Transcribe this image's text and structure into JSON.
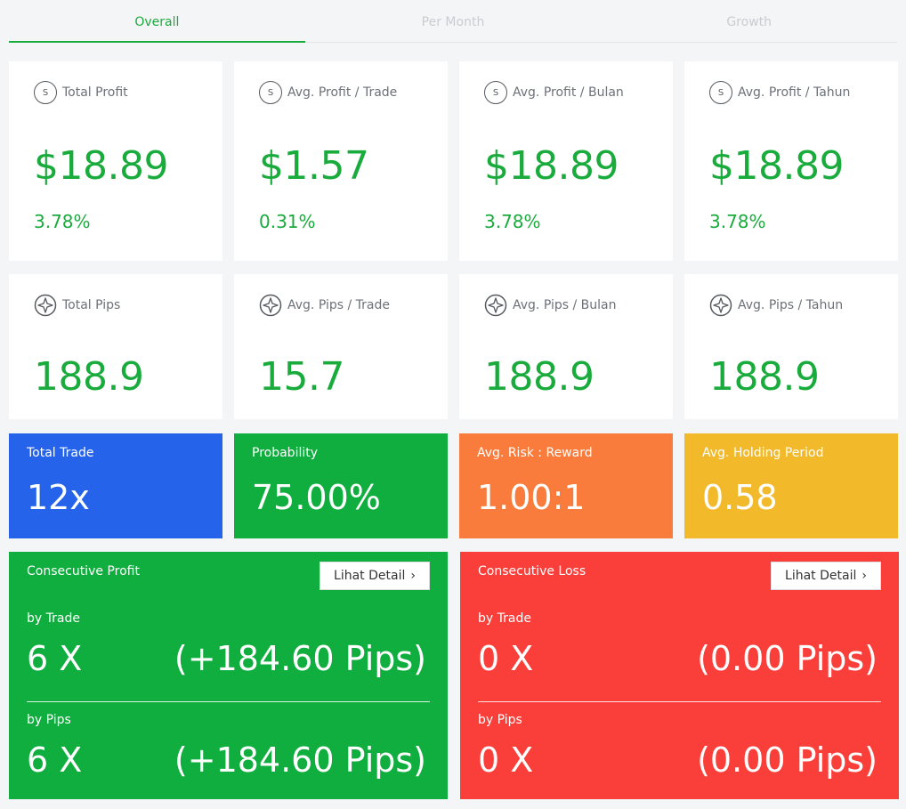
{
  "tabs": [
    "Overall",
    "Per Month",
    "Growth"
  ],
  "profit_cards": [
    {
      "label": "Total Profit",
      "value": "$18.89",
      "pct": "3.78%",
      "icon": "dollar-coin-icon"
    },
    {
      "label": "Avg. Profit / Trade",
      "value": "$1.57",
      "pct": "0.31%",
      "icon": "dollar-coin-icon"
    },
    {
      "label": "Avg. Profit / Bulan",
      "value": "$18.89",
      "pct": "3.78%",
      "icon": "dollar-coin-icon"
    },
    {
      "label": "Avg. Profit / Tahun",
      "value": "$18.89",
      "pct": "3.78%",
      "icon": "dollar-coin-icon"
    }
  ],
  "coin_symbol": "S",
  "pips_cards": [
    {
      "label": "Total Pips",
      "value": "188.9",
      "icon": "sparkle-icon"
    },
    {
      "label": "Avg. Pips / Trade",
      "value": "15.7",
      "icon": "sparkle-icon"
    },
    {
      "label": "Avg. Pips / Bulan",
      "value": "188.9",
      "icon": "sparkle-icon"
    },
    {
      "label": "Avg. Pips / Tahun",
      "value": "188.9",
      "icon": "sparkle-icon"
    }
  ],
  "stats": [
    {
      "label": "Total Trade",
      "value": "12x",
      "color": "#2563eb"
    },
    {
      "label": "Probability",
      "value": "75.00%",
      "color": "#0fae3e"
    },
    {
      "label": "Avg. Risk : Reward",
      "value": "1.00:1",
      "color": "#fa7c3c"
    },
    {
      "label": "Avg. Holding Period",
      "value": "0.58",
      "color": "#f2b92b"
    }
  ],
  "consecutive": [
    {
      "title": "Consecutive Profit",
      "button": "Lihat Detail",
      "color": "#0fae3e",
      "by_trade_label": "by Trade",
      "by_trade_count": "6 X",
      "by_trade_pips": "(+184.60 Pips)",
      "by_pips_label": "by Pips",
      "by_pips_count": "6 X",
      "by_pips_pips": "(+184.60 Pips)"
    },
    {
      "title": "Consecutive Loss",
      "button": "Lihat Detail",
      "color": "#fa3f3a",
      "by_trade_label": "by Trade",
      "by_trade_count": "0 X",
      "by_trade_pips": "(0.00 Pips)",
      "by_pips_label": "by Pips",
      "by_pips_count": "0 X",
      "by_pips_pips": "(0.00 Pips)"
    }
  ],
  "colors": {
    "accent_green": "#1aab3d"
  }
}
